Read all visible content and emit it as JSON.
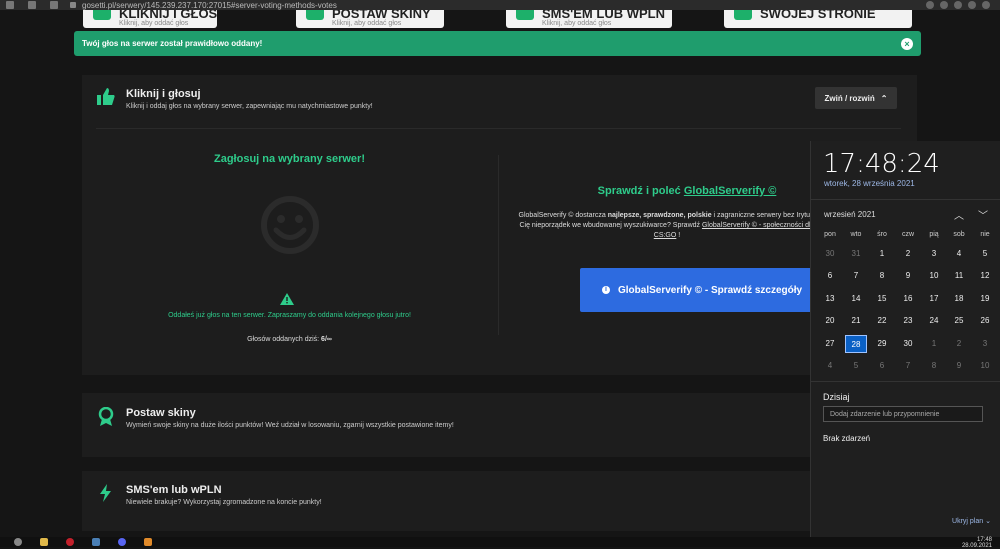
{
  "browser": {
    "url": "gosetti.pl/serwery/145.239.237.170:27015#server-voting-methods-votes"
  },
  "nav_tiles": [
    {
      "title": "KLIKNIJ I GŁOSUJ",
      "sub": "Kliknij, aby oddać głos"
    },
    {
      "title": "POSTAW SKINY",
      "sub": "Kliknij, aby oddać głos"
    },
    {
      "title": "SMS'EM LUB WPLN",
      "sub": "Kliknij, aby oddać głos"
    },
    {
      "title": "SWOJEJ STRONIE",
      "sub": ""
    }
  ],
  "alert": {
    "text": "Twój głos na serwer został prawidłowo oddany!",
    "close": "×"
  },
  "vote_card": {
    "title": "Kliknij i głosuj",
    "subtitle": "Kliknij i oddaj głos na wybrany serwer, zapewniając mu natychmiastowe punkty!",
    "toggle_label": "Zwiń / rozwiń",
    "vote_heading": "Zagłosuj na wybrany serwer!",
    "voted_message": "Oddałeś już głos na ten serwer. Zapraszamy do oddania kolejnego głosu jutro!",
    "votes_today_label": "Głosów oddanych dziś:",
    "votes_today_value": "6/∞",
    "gs_heading_prefix": "Sprawdź i poleć ",
    "gs_heading_link": "GlobalServerify ©",
    "gs_desc_1": "GlobalServerify © dostarcza ",
    "gs_desc_bold": "najlepsze, sprawdzone, polskie",
    "gs_desc_2": " i zagraniczne serwery bez Irytuje Cię nieporządek we wbudowanej wyszukiwarce? Sprawdź ",
    "gs_desc_link": "GlobalServerify © - społeczności dla CS:GO",
    "gs_desc_3": "!",
    "gs_button": "GlobalServerify © - Sprawdź szczegóły"
  },
  "skins_card": {
    "title": "Postaw skiny",
    "subtitle": "Wymień swoje skiny na duże ilości punktów! Weź udział w losowaniu, zgarnij wszystkie postawione itemy!"
  },
  "sms_card": {
    "title": "SMS'em lub wPLN",
    "subtitle": "Niewiele brakuje? Wykorzystaj zgromadzone na koncie punkty!"
  },
  "calendar": {
    "time": "17:48:24",
    "date": "wtorek, 28 września 2021",
    "month": "wrzesień 2021",
    "weekdays": [
      "pon",
      "wto",
      "śro",
      "czw",
      "pią",
      "sob",
      "nie"
    ],
    "weeks": [
      [
        "30",
        "31",
        "1",
        "2",
        "3",
        "4",
        "5"
      ],
      [
        "6",
        "7",
        "8",
        "9",
        "10",
        "11",
        "12"
      ],
      [
        "13",
        "14",
        "15",
        "16",
        "17",
        "18",
        "19"
      ],
      [
        "20",
        "21",
        "22",
        "23",
        "24",
        "25",
        "26"
      ],
      [
        "27",
        "28",
        "29",
        "30",
        "1",
        "2",
        "3"
      ],
      [
        "4",
        "5",
        "6",
        "7",
        "8",
        "9",
        "10"
      ]
    ],
    "selected": "28",
    "today_label": "Dzisiaj",
    "add_event_placeholder": "Dodaj zdarzenie lub przypomnienie",
    "no_events": "Brak zdarzeń",
    "hide_plan": "Ukryj plan"
  },
  "taskbar": {
    "time": "17:48",
    "date": "28.09.2021"
  },
  "colors": {
    "accent_green": "#1f9d6d",
    "text_green": "#2ecc8b",
    "button_blue": "#2d6be0",
    "selected_day": "#0a60c5"
  }
}
